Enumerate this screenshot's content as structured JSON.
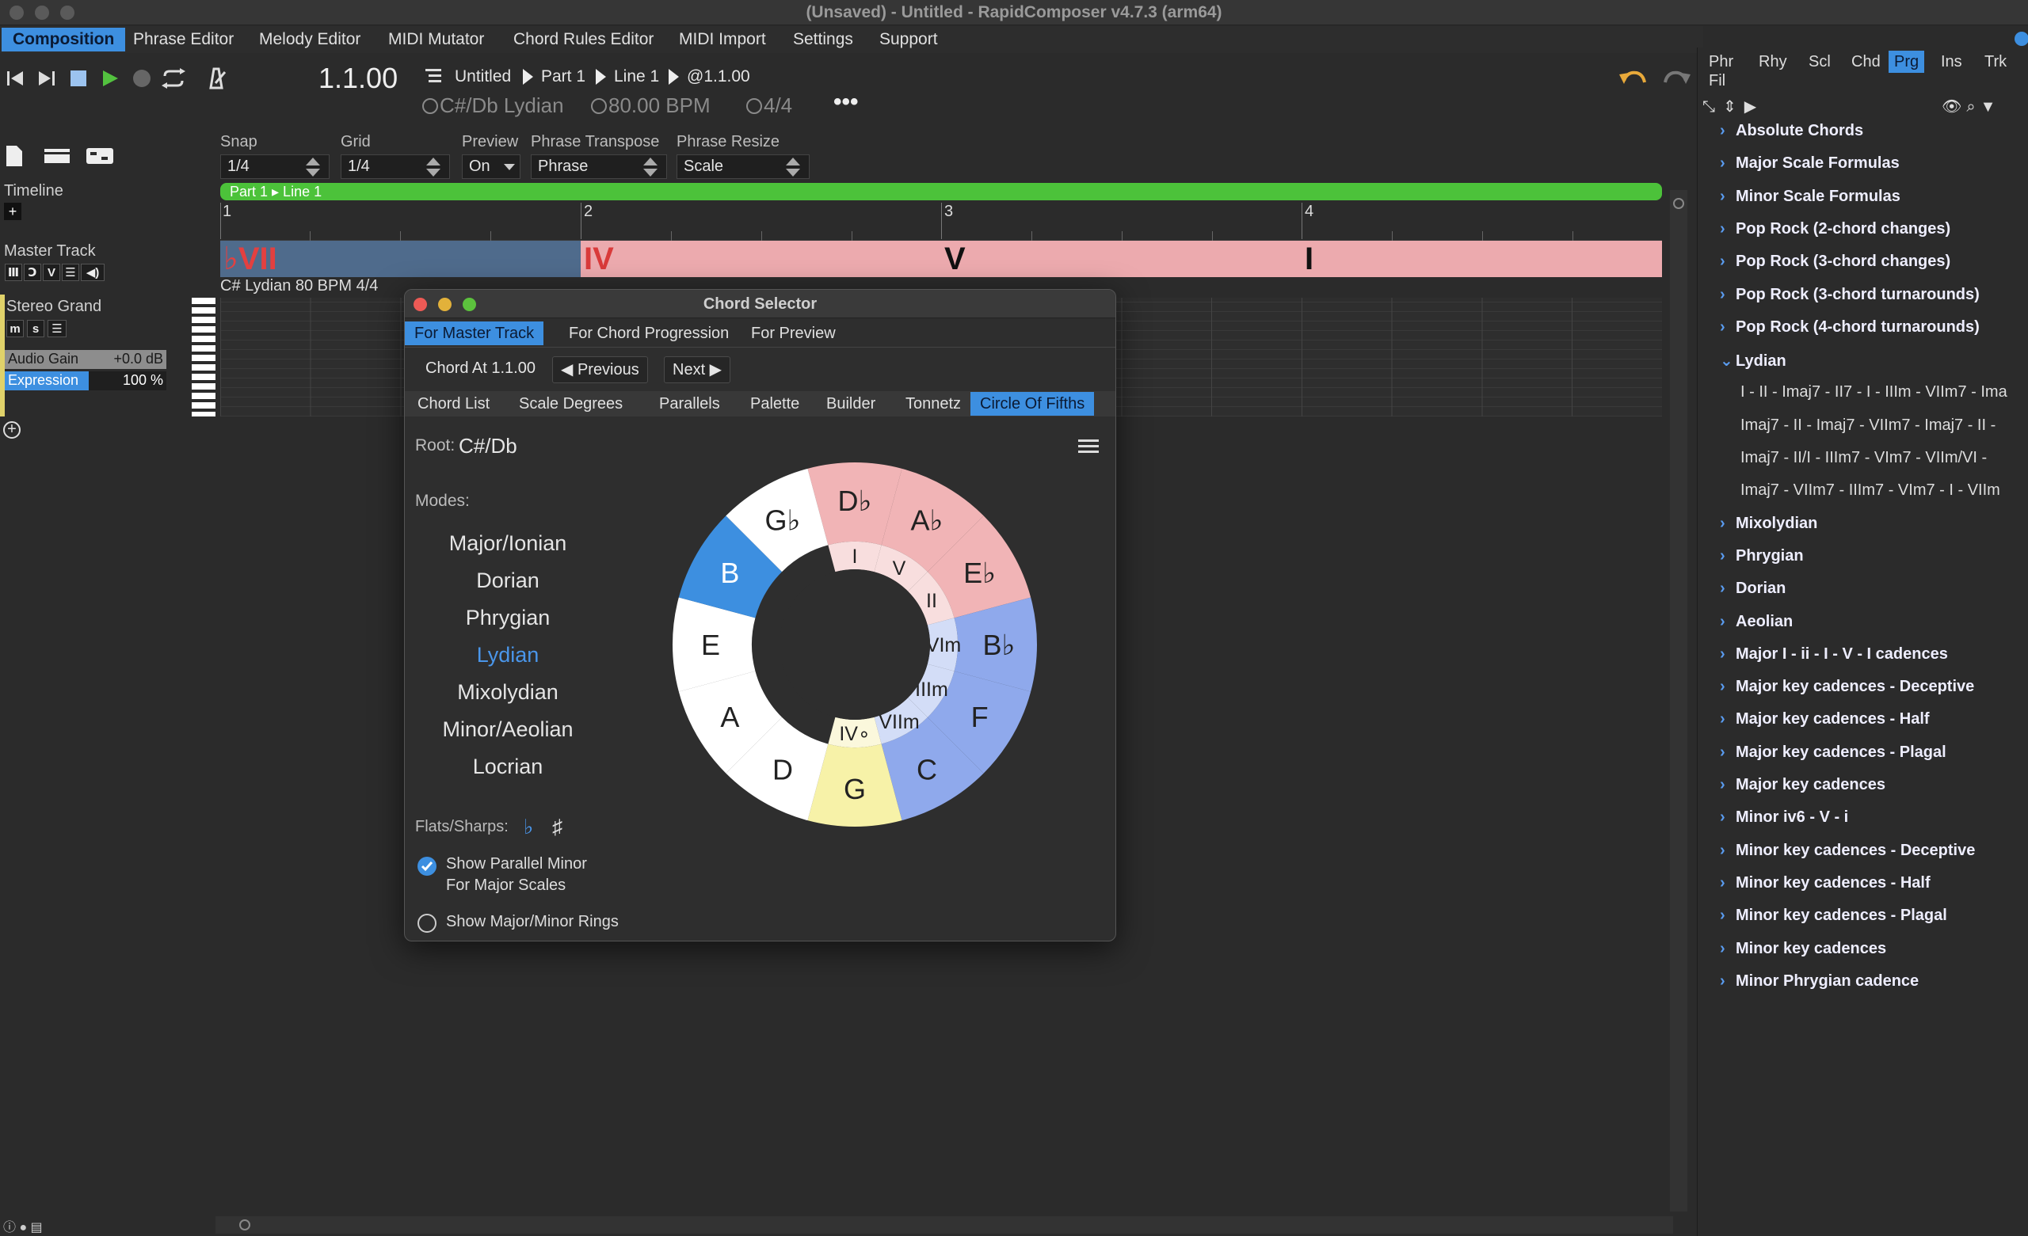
{
  "window": {
    "title": "(Unsaved) - Untitled - RapidComposer v4.7.3 (arm64)"
  },
  "menu": [
    "Composition",
    "Phrase Editor",
    "Melody Editor",
    "MIDI Mutator",
    "Chord Rules Editor",
    "MIDI Import",
    "Settings",
    "Support"
  ],
  "transport": {
    "position": "1.1.00",
    "breadcrumb": [
      "Untitled",
      "Part 1",
      "Line 1",
      "@1.1.00"
    ],
    "key": "C#/Db Lydian",
    "tempo": "80.00 BPM",
    "meter": "4/4",
    "more": "•••"
  },
  "controls": {
    "snap": {
      "label": "Snap",
      "value": "1/4"
    },
    "grid": {
      "label": "Grid",
      "value": "1/4"
    },
    "preview": {
      "label": "Preview",
      "value": "On"
    },
    "phrase_transpose": {
      "label": "Phrase Transpose",
      "value": "Phrase"
    },
    "phrase_resize": {
      "label": "Phrase Resize",
      "value": "Scale"
    }
  },
  "left": {
    "timeline": "Timeline",
    "master_track": "Master Track",
    "instrument": "Stereo Grand",
    "audio_gain_label": "Audio Gain",
    "audio_gain_value": "+0.0 dB",
    "expression_label": "Expression",
    "expression_value": "100 %",
    "master_buttons": [
      "Ⅲ",
      "Ↄ",
      "V",
      "☰",
      "◀)"
    ],
    "track_buttons": [
      "m",
      "s",
      "☰"
    ]
  },
  "timeline": {
    "region_label": "Part 1 ▸ Line 1",
    "bars": [
      "1",
      "2",
      "3",
      "4"
    ],
    "chords": [
      {
        "label": "♭VII",
        "color": "#4f6b8c",
        "text_color": "#e34040"
      },
      {
        "label": "IV",
        "color": "#ecaaae",
        "text_color": "#d93a3a"
      },
      {
        "label": "V",
        "color": "#ecaaae",
        "text_color": "#111111"
      },
      {
        "label": "I",
        "color": "#ecaaae",
        "text_color": "#111111"
      }
    ],
    "track_info": "C# Lydian 80 BPM 4/4"
  },
  "right_panel": {
    "tabs": [
      "Phr",
      "Rhy",
      "Scl",
      "Chd",
      "Prg",
      "Ins",
      "Trk",
      "Fil"
    ],
    "active_tab": "Prg",
    "tree": [
      {
        "label": "Absolute Chords",
        "open": false
      },
      {
        "label": "Major Scale Formulas",
        "open": false
      },
      {
        "label": "Minor Scale Formulas",
        "open": false
      },
      {
        "label": "Pop Rock (2-chord changes)",
        "open": false
      },
      {
        "label": "Pop Rock (3-chord changes)",
        "open": false
      },
      {
        "label": "Pop Rock (3-chord turnarounds)",
        "open": false
      },
      {
        "label": "Pop Rock (4-chord turnarounds)",
        "open": false
      },
      {
        "label": "Lydian",
        "open": true
      },
      {
        "label": "I - II - Imaj7 - II7 - I - IIIm - VIIm7 - Ima",
        "sub": true
      },
      {
        "label": "Imaj7 - II - Imaj7 - VIIm7 - Imaj7 - II -",
        "sub": true
      },
      {
        "label": "Imaj7 - II/I - IIIm7 - VIm7 - VIIm/VI -",
        "sub": true
      },
      {
        "label": "Imaj7 - VIIm7 - IIIm7 - VIm7 - I - VIIm",
        "sub": true
      },
      {
        "label": "Mixolydian",
        "open": false
      },
      {
        "label": "Phrygian",
        "open": false
      },
      {
        "label": "Dorian",
        "open": false
      },
      {
        "label": "Aeolian",
        "open": false
      },
      {
        "label": "Major I - ii - I - V - I cadences",
        "open": false
      },
      {
        "label": "Major key cadences - Deceptive",
        "open": false
      },
      {
        "label": "Major key cadences - Half",
        "open": false
      },
      {
        "label": "Major key cadences - Plagal",
        "open": false
      },
      {
        "label": "Major key cadences",
        "open": false
      },
      {
        "label": "Minor iv6 - V - i",
        "open": false
      },
      {
        "label": "Minor key cadences - Deceptive",
        "open": false
      },
      {
        "label": "Minor key cadences - Half",
        "open": false
      },
      {
        "label": "Minor key cadences - Plagal",
        "open": false
      },
      {
        "label": "Minor key cadences",
        "open": false
      },
      {
        "label": "Minor Phrygian cadence",
        "open": false
      }
    ]
  },
  "dialog": {
    "title": "Chord Selector",
    "top_tabs": [
      "For Master Track",
      "For Chord Progression",
      "For Preview"
    ],
    "active_top_tab": "For Master Track",
    "chord_at": "Chord At 1.1.00",
    "prev": "◀ Previous",
    "next": "Next ▶",
    "sub_tabs": [
      "Chord List",
      "Scale Degrees",
      "Parallels",
      "Palette",
      "Builder",
      "Tonnetz",
      "Circle Of Fifths"
    ],
    "active_sub_tab": "Circle Of Fifths",
    "root_label": "Root:",
    "root_value": "C#/Db",
    "modes_label": "Modes:",
    "modes": [
      "Major/Ionian",
      "Dorian",
      "Phrygian",
      "Lydian",
      "Mixolydian",
      "Minor/Aeolian",
      "Locrian"
    ],
    "selected_mode": "Lydian",
    "flats_sharps_label": "Flats/Sharps:",
    "flat_symbol": "♭",
    "sharp_symbol": "♯",
    "option1_line1": "Show Parallel Minor",
    "option1_line2": "For Major Scales",
    "option1_checked": true,
    "option2": "Show Major/Minor Rings",
    "option2_checked": false,
    "circle_outer": [
      {
        "label": "D♭",
        "color": "#f1b4b6"
      },
      {
        "label": "A♭",
        "color": "#f1b4b6"
      },
      {
        "label": "E♭",
        "color": "#f1b4b6"
      },
      {
        "label": "B♭",
        "color": "#8fa9ec"
      },
      {
        "label": "F",
        "color": "#8fa9ec"
      },
      {
        "label": "C",
        "color": "#8fa9ec"
      },
      {
        "label": "G",
        "color": "#f7f2a8"
      },
      {
        "label": "D",
        "color": "#ffffff"
      },
      {
        "label": "A",
        "color": "#ffffff"
      },
      {
        "label": "E",
        "color": "#ffffff"
      },
      {
        "label": "B",
        "color": "#3d8fe0"
      },
      {
        "label": "G♭",
        "color": "#ffffff"
      }
    ],
    "circle_inner": [
      {
        "label": "I",
        "color": "#f8dede"
      },
      {
        "label": "V",
        "color": "#f8dede"
      },
      {
        "label": "II",
        "color": "#f8dede"
      },
      {
        "label": "VIm",
        "color": "#d3ddf7"
      },
      {
        "label": "IIIm",
        "color": "#d3ddf7"
      },
      {
        "label": "VIIm",
        "color": "#d3ddf7"
      },
      {
        "label": "IV∘",
        "color": "#fbf8dc"
      }
    ]
  }
}
